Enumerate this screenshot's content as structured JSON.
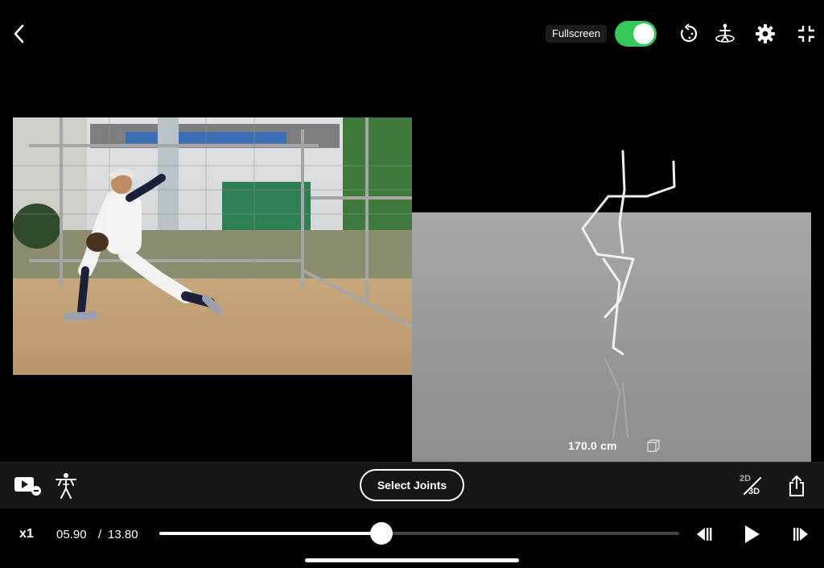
{
  "topbar": {
    "fullscreen_label": "Fullscreen",
    "fullscreen_on": true,
    "icons": [
      "back-chevron-icon",
      "reset-rotation-icon",
      "camera-orbit-icon",
      "gear-icon",
      "exit-fullscreen-icon"
    ]
  },
  "view3d": {
    "height_readout": "170.0 cm",
    "cube_icon": "cube-icon"
  },
  "toolbar": {
    "select_joints_label": "Select Joints",
    "toggle_2d": "2D",
    "toggle_3d": "3D",
    "icons": [
      "video-overlay-icon",
      "skeleton-figure-icon",
      "share-icon"
    ]
  },
  "playback": {
    "speed": "x1",
    "current_time": "05.90",
    "separator": "/",
    "total_time": "13.80",
    "progress": 0.4275,
    "icons": [
      "step-back-icon",
      "play-icon",
      "step-forward-icon"
    ]
  },
  "colors": {
    "toggle_on": "#34c759",
    "toolbar_bg": "#161616",
    "floor": "#9a9a9a"
  }
}
